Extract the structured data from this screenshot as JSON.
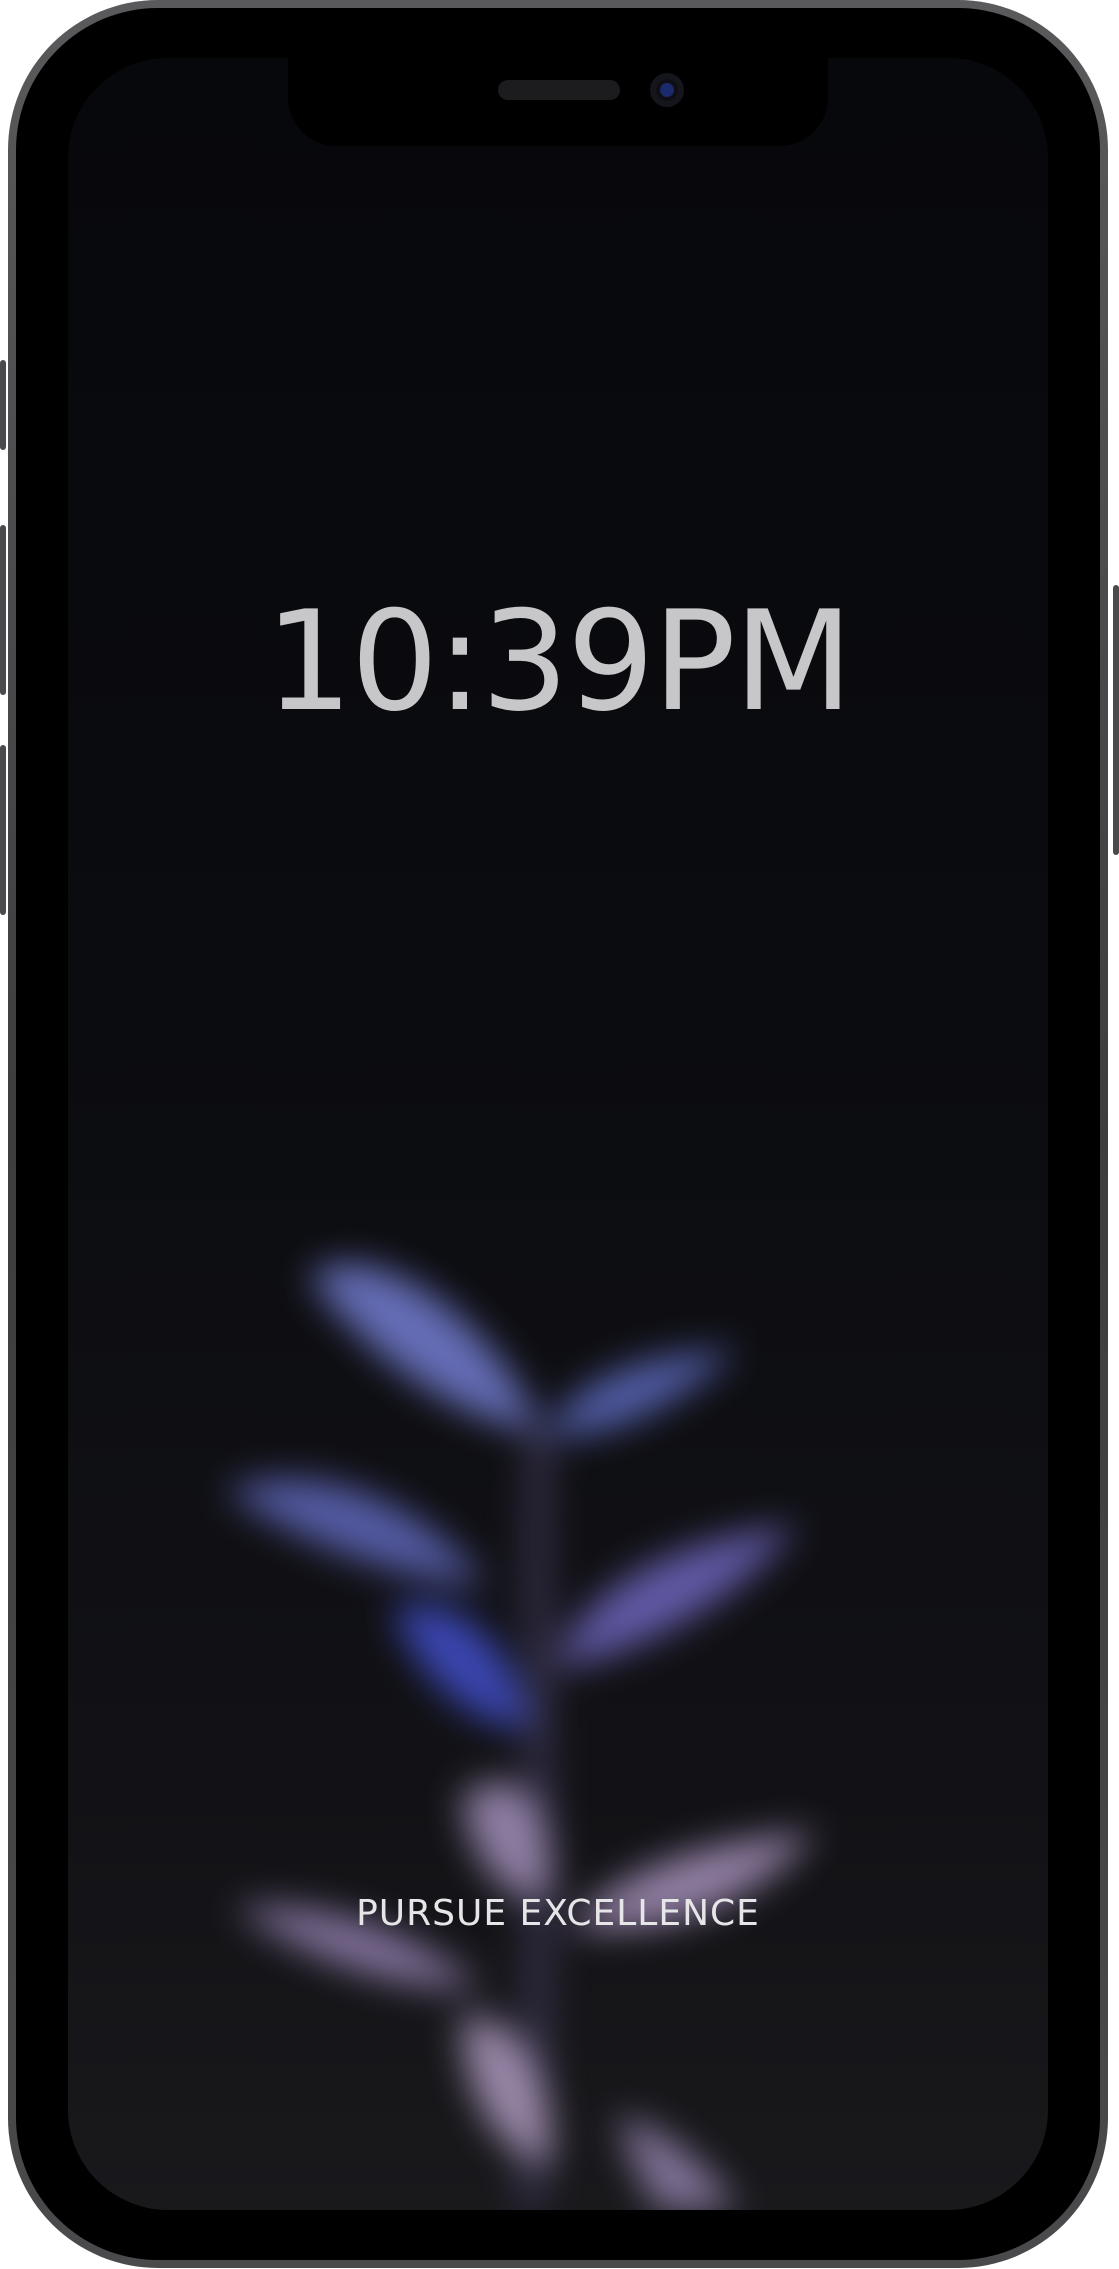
{
  "lock_screen": {
    "time": "10:39PM",
    "tagline": "PURSUE EXCELLENCE"
  },
  "colors": {
    "frame": "#4a4a4c",
    "background_top": "#07080c",
    "background_bottom": "#19191c",
    "clock_text": "#c7c7c9",
    "tagline_text": "#e6e6e8",
    "leaf_blue": "#4a55b8",
    "leaf_violet": "#8a7fc4",
    "leaf_pink": "#a892b8"
  },
  "icons": {
    "wallpaper": "blurred-plant-illustration",
    "camera": "front-camera-icon",
    "speaker": "earpiece-speaker-icon"
  }
}
